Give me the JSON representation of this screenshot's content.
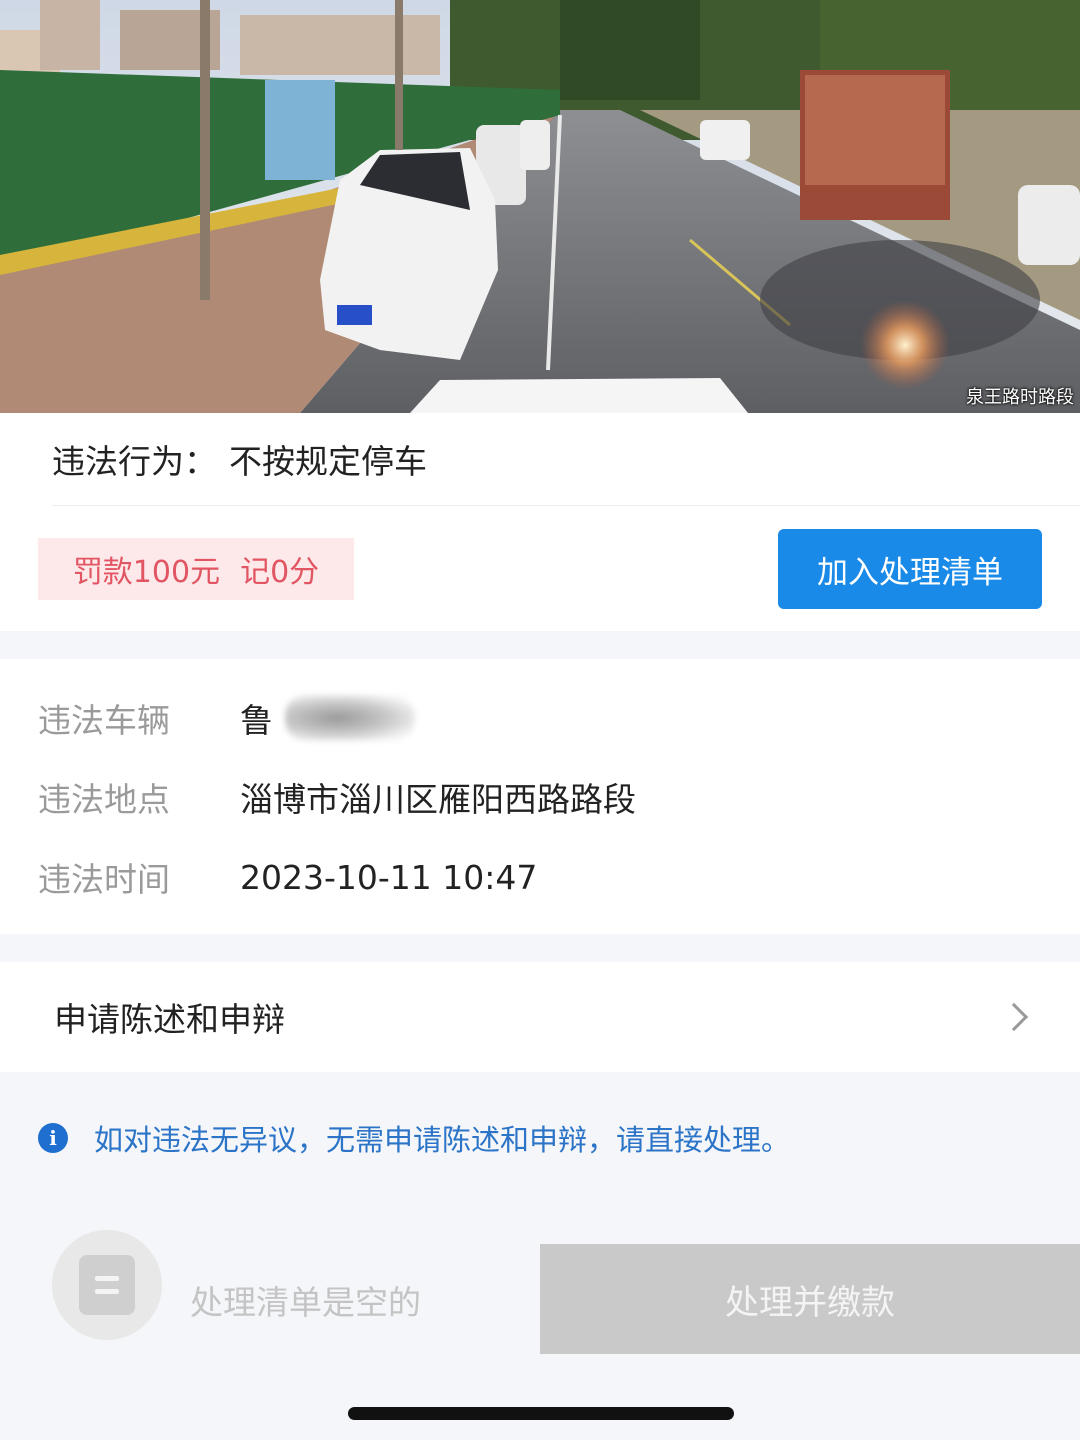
{
  "photo": {
    "caption": "泉王路时路段"
  },
  "violation": {
    "behavior_label": "违法行为：",
    "behavior_value": "不按规定停车",
    "fine_text": "罚款100元",
    "points_text": "记0分",
    "add_button_label": "加入处理清单"
  },
  "details": {
    "vehicle_label": "违法车辆",
    "vehicle_value": "鲁",
    "location_label": "违法地点",
    "location_value": "淄博市淄川区雁阳西路路段",
    "time_label": "违法时间",
    "time_value": "2023-10-11 10:47"
  },
  "appeal": {
    "label": "申请陈述和申辩"
  },
  "tip": {
    "icon_text": "i",
    "text": "如对违法无异议，无需申请陈述和申辩，请直接处理。"
  },
  "bottom_bar": {
    "empty_text": "处理清单是空的",
    "pay_button_label": "处理并缴款"
  },
  "colors": {
    "primary_button": "#1a8ae8",
    "fine_badge_bg": "#fde9ea",
    "fine_badge_text": "#e25563",
    "tip_text": "#2b74c7",
    "disabled_button": "#c9c9c9"
  }
}
